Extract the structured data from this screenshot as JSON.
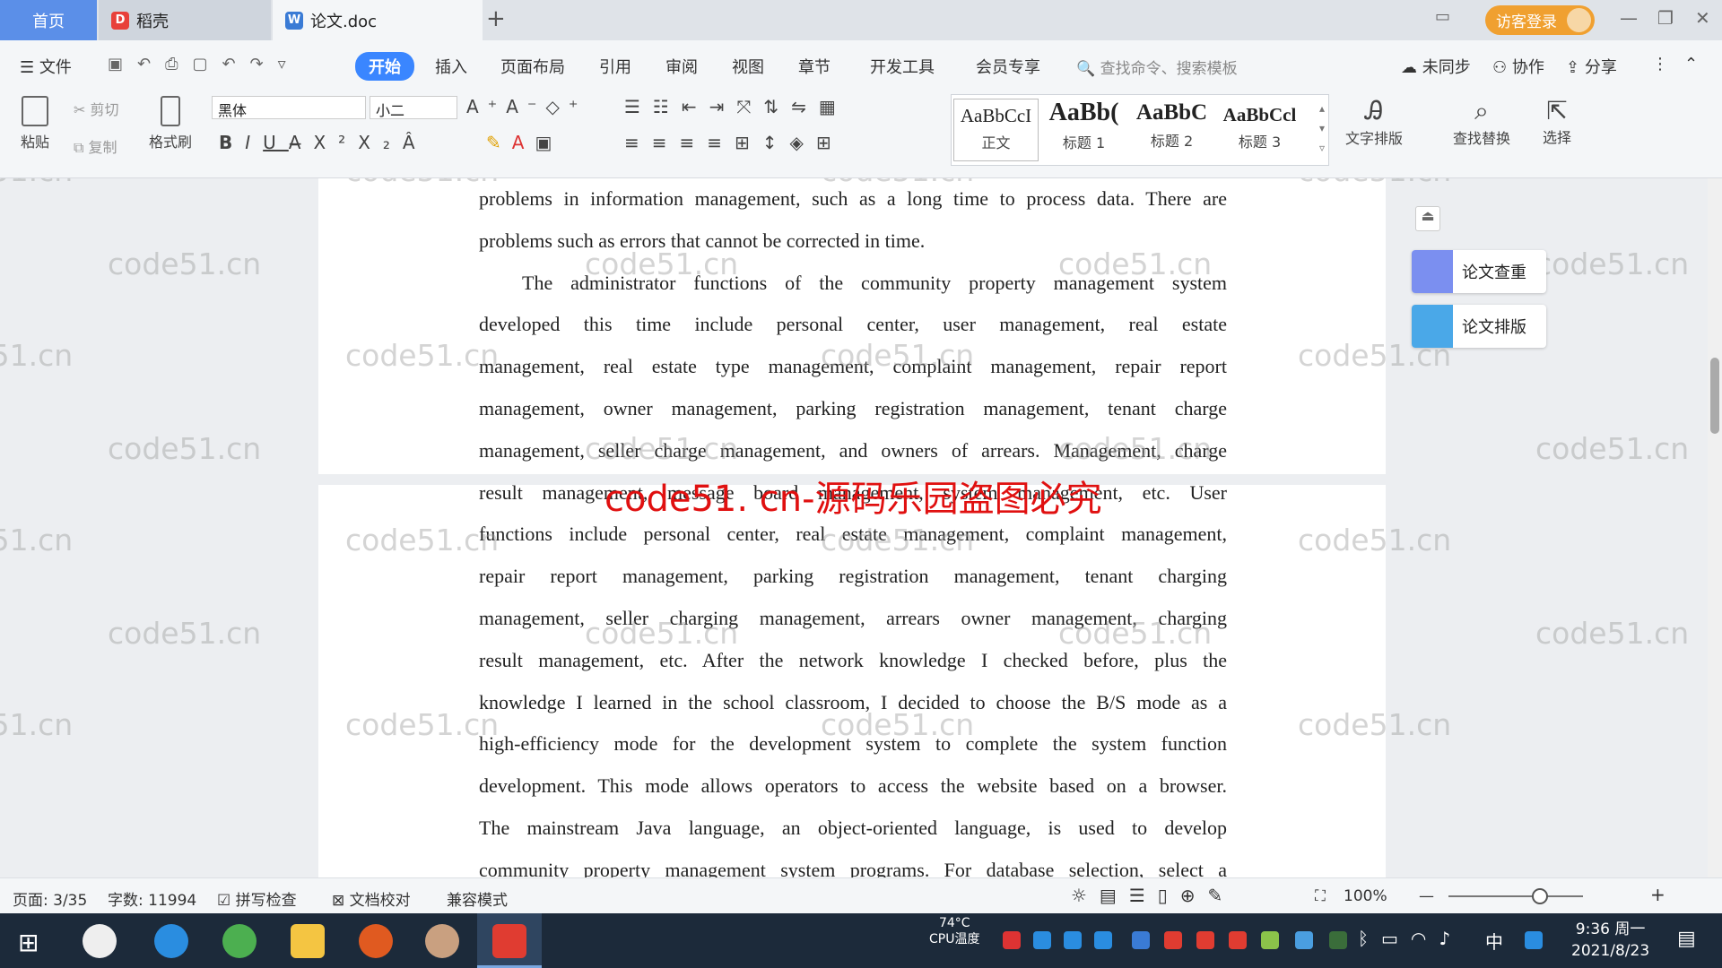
{
  "tabs": {
    "home": "首页",
    "daoke": "稻壳",
    "doc": "论文.doc"
  },
  "titlebar": {
    "login": "访客登录"
  },
  "menu": {
    "file": "文件",
    "start": "开始",
    "insert": "插入",
    "layout": "页面布局",
    "reference": "引用",
    "review": "审阅",
    "view": "视图",
    "chapter": "章节",
    "devtools": "开发工具",
    "member": "会员专享",
    "search": "查找命令、搜索模板",
    "unsync": "未同步",
    "collab": "协作",
    "share": "分享"
  },
  "ribbon": {
    "paste": "粘贴",
    "cut": "剪切",
    "copy": "复制",
    "format_painter": "格式刷",
    "font": "黑体",
    "size": "小二",
    "style_preview": "AaBbCcI",
    "style_heading_preview": "AaBb(",
    "style_heading2_preview": "AaBbC",
    "style_heading3_preview": "AaBbCcl",
    "style_normal": "正文",
    "style_h1": "标题 1",
    "style_h2": "标题 2",
    "style_h3": "标题 3",
    "text_layout": "文字排版",
    "find_replace": "查找替换",
    "select": "选择"
  },
  "side": {
    "check": "论文查重",
    "typeset": "论文排版"
  },
  "document": {
    "lines": [
      "problems in information management, such as a long time to process data. There are",
      "problems such as errors that cannot be corrected in time.",
      "The administrator functions of the community property management system",
      "developed this time include personal center, user management, real estate",
      "management, real estate type management, complaint management, repair report",
      "management, owner management, parking registration management, tenant charge",
      "management, seller charge management, and owners of arrears. Management, charge",
      "result management, message board management, system management, etc. User",
      "functions include personal center, real estate management, complaint management,",
      "repair report management, parking registration management, tenant charging",
      "management, seller charging management, arrears owner management, charging",
      "result management, etc. After the network knowledge I checked before, plus the",
      "knowledge I learned in the school classroom, I decided to choose the B/S mode as a",
      "high-efficiency mode for the development system to complete the system function",
      "development. This mode allows operators to access the website based on a browser.",
      "The mainstream Java language, an object-oriented language, is used to develop",
      "community property management system programs. For database selection, select a"
    ],
    "watermark": "code51.cn",
    "center_watermark": "code51. cn-源码乐园盗图必究"
  },
  "status": {
    "page": "页面: 3/35",
    "words": "字数: 11994",
    "spell": "拼写检查",
    "proof": "文档校对",
    "compat": "兼容模式",
    "zoom": "100%"
  },
  "taskbar": {
    "cpu_temp": "74°C",
    "cpu_label": "CPU温度",
    "ime": "中",
    "time": "9:36 周一",
    "date": "2021/8/23"
  },
  "colors": {
    "accent": "#3a86ff",
    "watermark_red": "#e01010",
    "taskbar": "#1c2a3a"
  }
}
